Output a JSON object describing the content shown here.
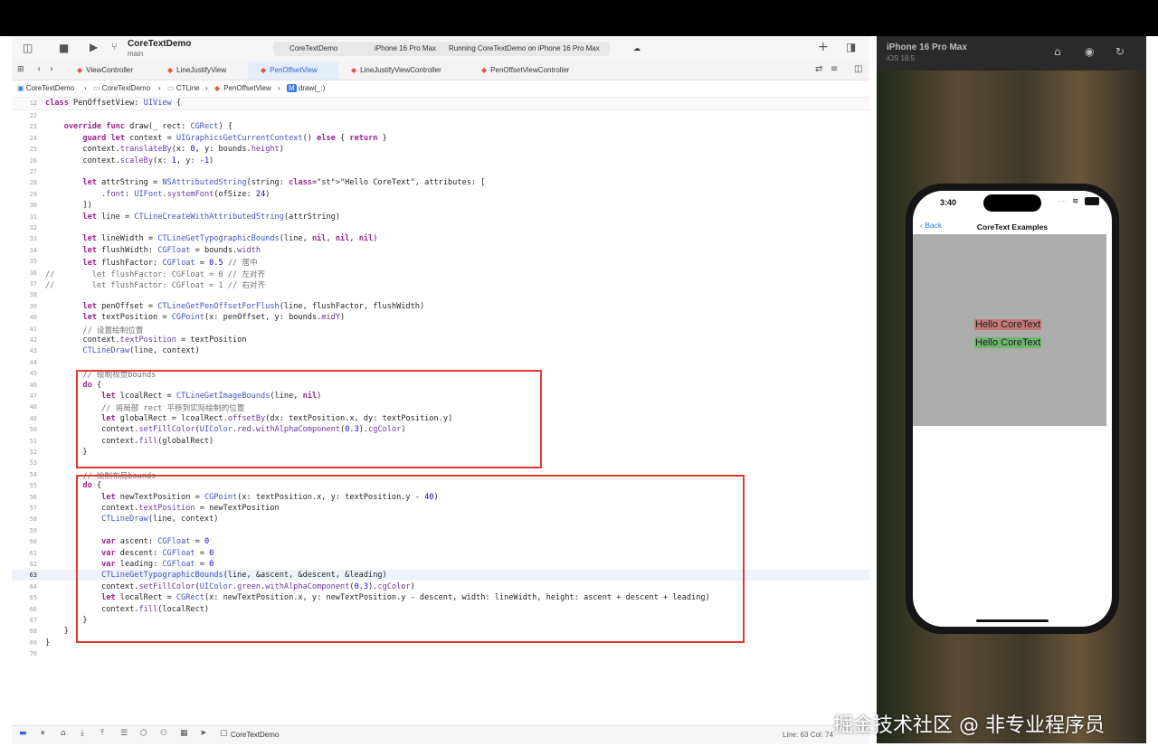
{
  "toolbar": {
    "project_name": "CoreTextDemo",
    "branch": "main",
    "scheme_project": "CoreTextDemo",
    "destination": "iPhone 16 Pro Max",
    "run_status": "Running CoreTextDemo on iPhone 16 Pro Max",
    "add_label": "+"
  },
  "tabs": [
    "ViewController",
    "LineJustifyView",
    "PenOffsetView",
    "LineJustifyViewController",
    "PenOffsetViewController"
  ],
  "breadcrumbs": [
    "CoreTextDemo",
    "CoreTextDemo",
    "CTLine",
    "PenOffsetView",
    "draw(_:)"
  ],
  "sticky": {
    "num": "12",
    "text": "class PenOffsetView: UIView {"
  },
  "code_lines": [
    {
      "num": "22",
      "text": ""
    },
    {
      "num": "23",
      "text": "    override func draw(_ rect: CGRect) {"
    },
    {
      "num": "24",
      "text": "        guard let context = UIGraphicsGetCurrentContext() else { return }"
    },
    {
      "num": "25",
      "text": "        context.translateBy(x: 0, y: bounds.height)"
    },
    {
      "num": "26",
      "text": "        context.scaleBy(x: 1, y: -1)"
    },
    {
      "num": "27",
      "text": ""
    },
    {
      "num": "28",
      "text": "        let attrString = NSAttributedString(string: \"Hello CoreText\", attributes: ["
    },
    {
      "num": "29",
      "text": "            .font: UIFont.systemFont(ofSize: 24)"
    },
    {
      "num": "30",
      "text": "        ])"
    },
    {
      "num": "31",
      "text": "        let line = CTLineCreateWithAttributedString(attrString)"
    },
    {
      "num": "32",
      "text": ""
    },
    {
      "num": "33",
      "text": "        let lineWidth = CTLineGetTypographicBounds(line, nil, nil, nil)"
    },
    {
      "num": "34",
      "text": "        let flushWidth: CGFloat = bounds.width"
    },
    {
      "num": "35",
      "text": "        let flushFactor: CGFloat = 0.5 // 居中"
    },
    {
      "num": "36",
      "text": "//        let flushFactor: CGFloat = 0 // 左对齐"
    },
    {
      "num": "37",
      "text": "//        let flushFactor: CGFloat = 1 // 右对齐"
    },
    {
      "num": "38",
      "text": ""
    },
    {
      "num": "39",
      "text": "        let penOffset = CTLineGetPenOffsetForFlush(line, flushFactor, flushWidth)"
    },
    {
      "num": "40",
      "text": "        let textPosition = CGPoint(x: penOffset, y: bounds.midY)"
    },
    {
      "num": "41",
      "text": "        // 设置绘制位置"
    },
    {
      "num": "42",
      "text": "        context.textPosition = textPosition"
    },
    {
      "num": "43",
      "text": "        CTLineDraw(line, context)"
    },
    {
      "num": "44",
      "text": ""
    },
    {
      "num": "45",
      "text": "        // 绘制视觉bounds"
    },
    {
      "num": "46",
      "text": "        do {"
    },
    {
      "num": "47",
      "text": "            let lcoalRect = CTLineGetImageBounds(line, nil)"
    },
    {
      "num": "48",
      "text": "            // 将局部 rect 平移到实际绘制的位置"
    },
    {
      "num": "49",
      "text": "            let globalRect = lcoalRect.offsetBy(dx: textPosition.x, dy: textPosition.y)"
    },
    {
      "num": "50",
      "text": "            context.setFillColor(UIColor.red.withAlphaComponent(0.3).cgColor)"
    },
    {
      "num": "51",
      "text": "            context.fill(globalRect)"
    },
    {
      "num": "52",
      "text": "        }"
    },
    {
      "num": "53",
      "text": ""
    },
    {
      "num": "54",
      "text": "        // 绘制布局bounds"
    },
    {
      "num": "55",
      "text": "        do {"
    },
    {
      "num": "56",
      "text": "            let newTextPosition = CGPoint(x: textPosition.x, y: textPosition.y - 40)"
    },
    {
      "num": "57",
      "text": "            context.textPosition = newTextPosition"
    },
    {
      "num": "58",
      "text": "            CTLineDraw(line, context)"
    },
    {
      "num": "59",
      "text": ""
    },
    {
      "num": "60",
      "text": "            var ascent: CGFloat = 0"
    },
    {
      "num": "61",
      "text": "            var descent: CGFloat = 0"
    },
    {
      "num": "62",
      "text": "            var leading: CGFloat = 0"
    },
    {
      "num": "63",
      "text": "            CTLineGetTypographicBounds(line, &ascent, &descent, &leading)"
    },
    {
      "num": "64",
      "text": "            context.setFillColor(UIColor.green.withAlphaComponent(0.3).cgColor)"
    },
    {
      "num": "65",
      "text": "            let localRect = CGRect(x: newTextPosition.x, y: newTextPosition.y - descent, width: lineWidth, height: ascent + descent + leading)"
    },
    {
      "num": "66",
      "text": "            context.fill(localRect)"
    },
    {
      "num": "67",
      "text": "        }"
    },
    {
      "num": "68",
      "text": "    }"
    },
    {
      "num": "69",
      "text": "}"
    },
    {
      "num": "70",
      "text": ""
    }
  ],
  "current_line": "63",
  "statusbar": {
    "target": "CoreTextDemo",
    "position": "Line: 63  Col: 74"
  },
  "simulator": {
    "device_name": "iPhone 16 Pro Max",
    "os_version": "iOS 18.5",
    "time": "3:40",
    "back_label": "Back",
    "nav_title": "CoreText Examples",
    "hello_red": "Hello CoreText",
    "hello_green": "Hello CoreText"
  },
  "watermark": "掘金技术社区 @ 非专业程序员",
  "colors": {
    "highlight_box": "#e23b2e",
    "accent": "#2a6bd8"
  }
}
